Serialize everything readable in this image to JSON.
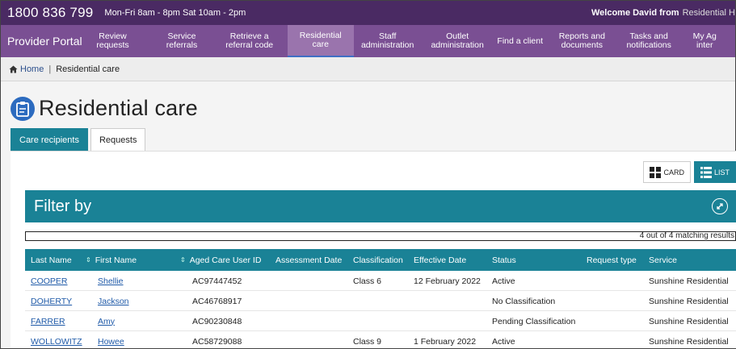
{
  "topbar": {
    "phone": "1800 836 799",
    "hours": "Mon-Fri 8am - 8pm Sat 10am - 2pm",
    "welcome": "Welcome David from",
    "org": "Residential H"
  },
  "nav": {
    "brand": "Provider Portal",
    "items": [
      {
        "label": "Review\nrequests"
      },
      {
        "label": "Service\nreferrals"
      },
      {
        "label": "Retrieve a\nreferral code"
      },
      {
        "label": "Residential\ncare"
      },
      {
        "label": "Staff\nadministration"
      },
      {
        "label": "Outlet\nadministration"
      },
      {
        "label": "Find a client"
      },
      {
        "label": "Reports and\ndocuments"
      },
      {
        "label": "Tasks and\nnotifications"
      },
      {
        "label": "My Ag\ninter"
      }
    ]
  },
  "breadcrumb": {
    "home": "Home",
    "separator": "|",
    "current": "Residential care"
  },
  "page": {
    "title": "Residential care",
    "icon": "clipboard-icon"
  },
  "tabs": [
    {
      "label": "Care recipients"
    },
    {
      "label": "Requests"
    }
  ],
  "view_toggle": {
    "card_label": "CARD",
    "list_label": "LIST"
  },
  "filter": {
    "title": "Filter by"
  },
  "results": {
    "text": "4 out of 4 matching results"
  },
  "table": {
    "headers": [
      "Last Name",
      "First Name",
      "Aged Care User ID",
      "Assessment Date",
      "Classification",
      "Effective Date",
      "Status",
      "Request type",
      "Service"
    ],
    "rows": [
      {
        "last": "COOPER",
        "first": "Shellie",
        "id": "AC97447452",
        "assessment": "",
        "classification": "Class 6",
        "effective": "12 February 2022",
        "status": "Active",
        "request": "",
        "service": "Sunshine Residential"
      },
      {
        "last": "DOHERTY",
        "first": "Jackson",
        "id": "AC46768917",
        "assessment": "",
        "classification": "",
        "effective": "",
        "status": "No Classification",
        "request": "",
        "service": "Sunshine Residential"
      },
      {
        "last": "FARRER",
        "first": "Amy",
        "id": "AC90230848",
        "assessment": "",
        "classification": "",
        "effective": "",
        "status": "Pending Classification",
        "request": "",
        "service": "Sunshine Residential"
      },
      {
        "last": "WOLLOWITZ",
        "first": "Howee",
        "id": "AC58729088",
        "assessment": "",
        "classification": "Class 9",
        "effective": "1 February 2022",
        "status": "Active",
        "request": "",
        "service": "Sunshine Residential"
      }
    ]
  },
  "colors": {
    "topbar": "#4a2a63",
    "navbar": "#7a4f93",
    "accent_teal": "#1a8296",
    "link": "#1f5aa8"
  }
}
